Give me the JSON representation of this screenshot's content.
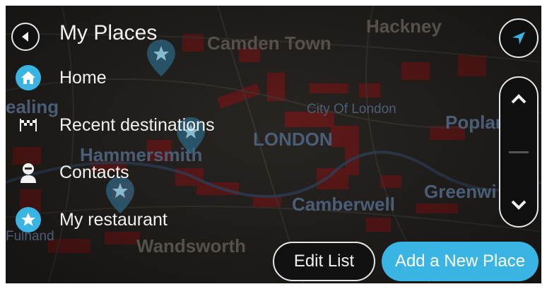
{
  "header": {
    "back_icon": "chevron-left-icon",
    "title": "My Places",
    "nav_icon": "navigation-arrow-icon"
  },
  "list": {
    "items": [
      {
        "label": "Home",
        "icon": "home-icon"
      },
      {
        "label": "Recent destinations",
        "icon": "checkered-flag-icon"
      },
      {
        "label": "Contacts",
        "icon": "contact-person-icon"
      },
      {
        "label": "My restaurant",
        "icon": "star-icon"
      }
    ]
  },
  "scroll": {
    "up_icon": "chevron-up-icon",
    "down_icon": "chevron-down-icon"
  },
  "buttons": {
    "edit": "Edit List",
    "add": "Add a New Place"
  },
  "map": {
    "labels": [
      "Camden Town",
      "Hackney",
      "City Of London",
      "LONDON",
      "Poplar",
      "ealing",
      "Hammersmith",
      "Camberwell",
      "Greenwi",
      "Wandsworth",
      "Fulhand"
    ]
  },
  "colors": {
    "accent": "#3ab5e3",
    "text": "#f2f2f2",
    "map_bg": "#2f2b27",
    "district": "#8a1c1c"
  }
}
